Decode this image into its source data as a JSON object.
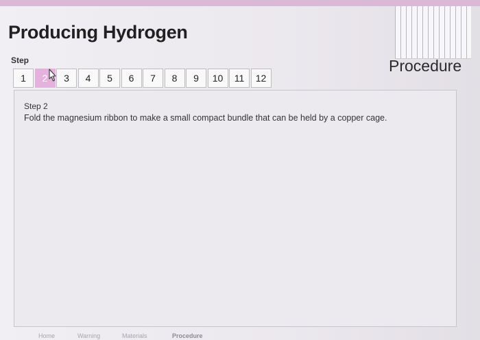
{
  "page": {
    "title": "Producing Hydrogen",
    "section_heading": "Procedure"
  },
  "step_nav": {
    "label": "Step",
    "active_index": 1,
    "steps": [
      "1",
      "2",
      "3",
      "4",
      "5",
      "6",
      "7",
      "8",
      "9",
      "10",
      "11",
      "12"
    ]
  },
  "content": {
    "step_title": "Step 2",
    "step_text": "Fold the magnesium ribbon to make a small compact bundle that can be held by a copper cage."
  },
  "bottom_nav": {
    "items": [
      "Home",
      "Warning",
      "Materials",
      "Procedure"
    ]
  },
  "colors": {
    "active_step": "#e5b2de",
    "top_band": "#d9b9d6"
  },
  "icons": {
    "cursor": "mouse-pointer-icon"
  }
}
